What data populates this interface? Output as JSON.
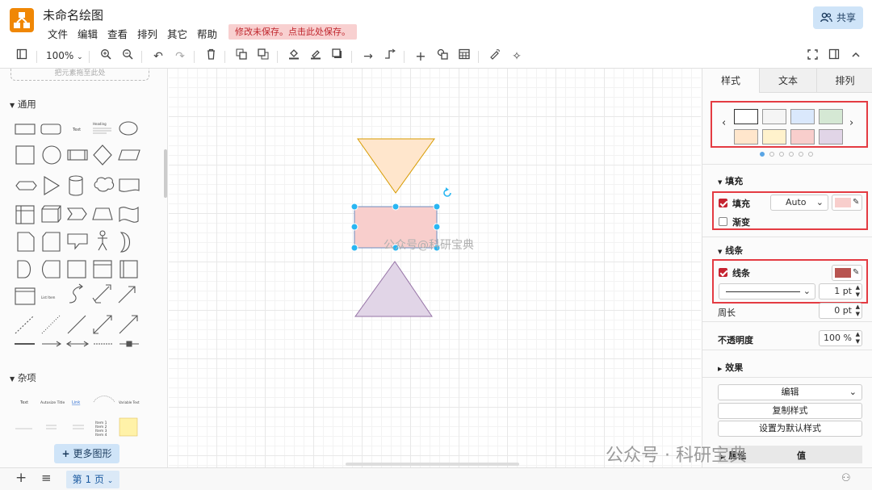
{
  "app": {
    "title": "未命名绘图",
    "menu": [
      "文件",
      "编辑",
      "查看",
      "排列",
      "其它",
      "帮助"
    ],
    "unsaved_notice": "修改未保存。点击此处保存。",
    "share_label": "共享"
  },
  "toolbar": {
    "zoom": "100%"
  },
  "sidebar": {
    "dropzone_text": "把元素拖至此处",
    "general_label": "通用",
    "misc_label": "杂项",
    "more_shapes_label": "更多图形"
  },
  "canvas": {
    "watermark": "公众号@科研宝典",
    "shapes": [
      {
        "type": "triangle-down",
        "fill": "#ffe6cc",
        "stroke": "#d79b00"
      },
      {
        "type": "rectangle",
        "fill": "#f8cecc",
        "stroke": "#b85450",
        "selected": true
      },
      {
        "type": "triangle-up",
        "fill": "#e1d5e7",
        "stroke": "#9673a6"
      }
    ]
  },
  "panel": {
    "tabs": [
      "样式",
      "文本",
      "排列"
    ],
    "swatches": [
      "#ffffff",
      "#f5f5f5",
      "#dae8fc",
      "#d5e8d4",
      "#ffe6cc",
      "#fff2cc",
      "#f8cecc",
      "#e1d5e7"
    ],
    "fill_section": "填充",
    "fill_label": "填充",
    "fill_value": "Auto",
    "fill_color": "#f8cecc",
    "gradient_label": "渐变",
    "line_section": "线条",
    "line_label": "线条",
    "line_color": "#b85450",
    "line_width": "1 pt",
    "perimeter_label": "周长",
    "perimeter_value": "0 pt",
    "opacity_label": "不透明度",
    "opacity_value": "100 %",
    "effects_label": "效果",
    "edit_label": "编辑",
    "copy_style_label": "复制样式",
    "set_default_label": "设置为默认样式",
    "prop_col": "属性",
    "value_col": "值"
  },
  "footer": {
    "page_label": "第 1 页",
    "watermark": "公众号 · 科研宝典"
  }
}
